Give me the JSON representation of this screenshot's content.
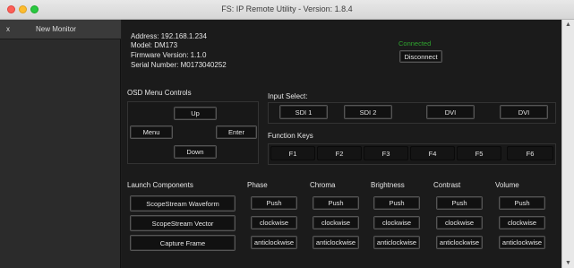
{
  "window": {
    "title": "FS: IP Remote Utility - Version: 1.8.4"
  },
  "tabs": [
    {
      "close": "x",
      "label": "New Monitor"
    }
  ],
  "device": {
    "address": "Address: 192.168.1.234",
    "model": "Model: DM173",
    "firmware": "Firmware Version: 1.1.0",
    "serial": "Serial Number: M0173040252",
    "status": "Connected",
    "disconnect_label": "Disconnect"
  },
  "osd": {
    "title": "OSD Menu Controls",
    "up": "Up",
    "menu": "Menu",
    "enter": "Enter",
    "down": "Down"
  },
  "input_select": {
    "title": "Input Select:",
    "inputs": [
      "SDI 1",
      "SDI 2",
      "DVI",
      "DVI"
    ]
  },
  "function_keys": {
    "title": "Function Keys",
    "keys": [
      "F1",
      "F2",
      "F3",
      "F4",
      "F5",
      "F6"
    ]
  },
  "launch": {
    "title": "Launch Components",
    "buttons": [
      "ScopeStream Waveform",
      "ScopeStream Vector",
      "Capture Frame"
    ]
  },
  "adjust": {
    "columns": [
      {
        "title": "Phase",
        "push": "Push",
        "cw": "clockwise",
        "ccw": "anticlockwise"
      },
      {
        "title": "Chroma",
        "push": "Push",
        "cw": "clockwise",
        "ccw": "anticlockwise"
      },
      {
        "title": "Brightness",
        "push": "Push",
        "cw": "clockwise",
        "ccw": "anticlockwise"
      },
      {
        "title": "Contrast",
        "push": "Push",
        "cw": "clockwise",
        "ccw": "anticlockwise"
      },
      {
        "title": "Volume",
        "push": "Push",
        "cw": "clockwise",
        "ccw": "anticlockwise"
      }
    ]
  },
  "colors": {
    "connected": "#2fa52f",
    "background": "#1b1b1b"
  }
}
